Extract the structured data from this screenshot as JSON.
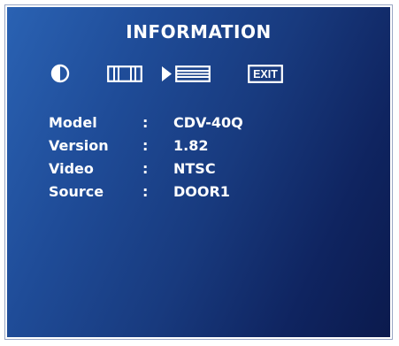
{
  "osd": {
    "title": "INFORMATION",
    "background_start": "#2a62b3",
    "background_end": "#0b1a4d",
    "icons": [
      {
        "name": "contrast-icon"
      },
      {
        "name": "horizontal-position-icon"
      },
      {
        "name": "selection-arrow-icon"
      },
      {
        "name": "information-menu-icon"
      },
      {
        "name": "exit-icon",
        "label": "EXIT"
      }
    ],
    "separator": ":",
    "info_rows": [
      {
        "label": "Model",
        "value": "CDV-40Q"
      },
      {
        "label": "Version",
        "value": "1.82"
      },
      {
        "label": "Video",
        "value": "NTSC"
      },
      {
        "label": "Source",
        "value": "DOOR1"
      }
    ]
  }
}
